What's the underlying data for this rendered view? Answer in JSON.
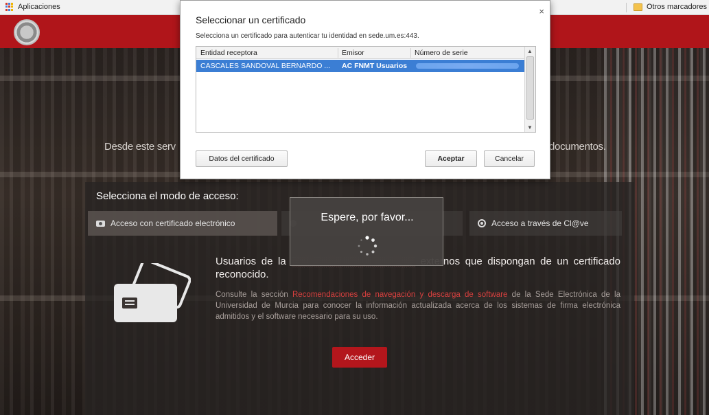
{
  "bookmarks": {
    "apps_label": "Aplicaciones",
    "other_label": "Otros marcadores"
  },
  "page": {
    "intro_left": "Desde este serv",
    "intro_right": "documentos."
  },
  "access": {
    "title": "Selecciona el modo de acceso:",
    "tabs": [
      {
        "label": "Acceso con certificado electrónico"
      },
      {
        "label": "Acceso a través de Cl@ve"
      }
    ],
    "heading_a": "Usuarios de la",
    "heading_b": "externos que dispongan de un certificado reconocido.",
    "para_a": "Consulte la sección",
    "para_link": "Recomendaciones de navegación y descarga de software",
    "para_b": "de la Sede Electrónica de la Universidad de Murcia para conocer la información actualizada acerca de los sistemas de firma electrónica admitidos y el software necesario para su uso.",
    "button_label": "Acceder"
  },
  "wait": {
    "text": "Espere, por favor..."
  },
  "dialog": {
    "title": "Seleccionar un certificado",
    "subtitle": "Selecciona un certificado para autenticar tu identidad en sede.um.es:443.",
    "columns": [
      "Entidad receptora",
      "Emisor",
      "Número de serie"
    ],
    "rows": [
      {
        "subject": "CASCALES SANDOVAL BERNARDO ...",
        "issuer": "AC FNMT Usuarios"
      }
    ],
    "details_label": "Datos del certificado",
    "accept_label": "Aceptar",
    "cancel_label": "Cancelar",
    "close_glyph": "×"
  },
  "colors": {
    "header_red": "#b0151a",
    "selection_blue": "#3b7ed4",
    "link_red": "#d9403f"
  }
}
